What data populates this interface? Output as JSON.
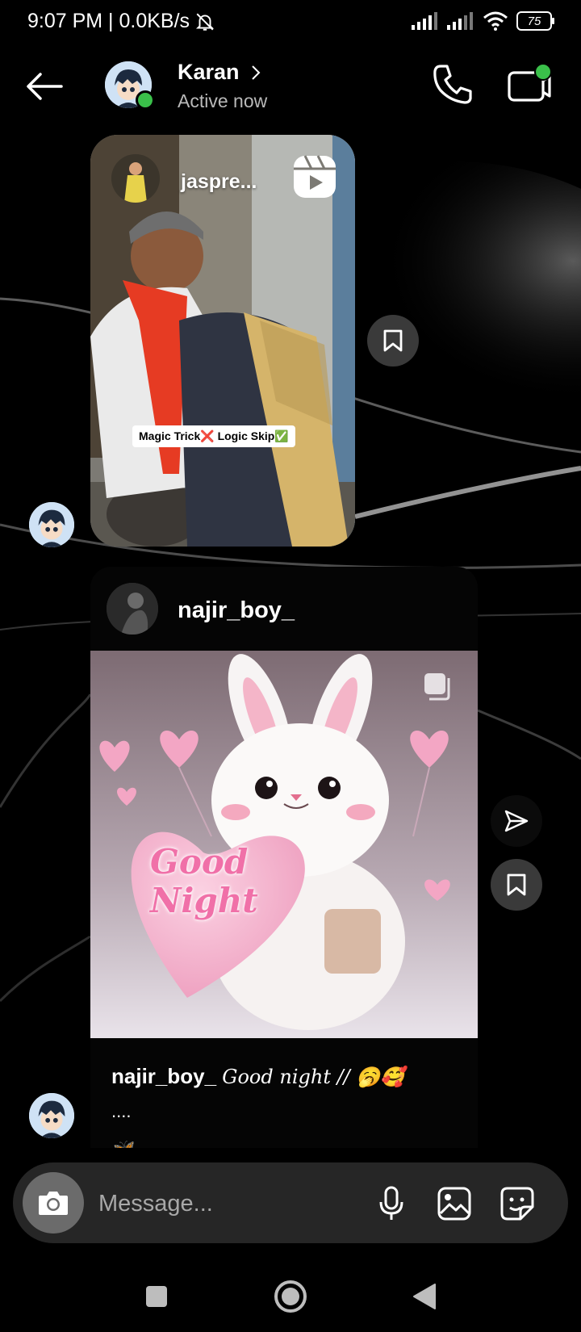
{
  "status_bar": {
    "time": "9:07 PM | 0.0KB/s",
    "battery": "75"
  },
  "header": {
    "contact_name": "Karan",
    "contact_status": "Active now",
    "icons": [
      "back-arrow-icon",
      "chevron-right-icon",
      "phone-icon",
      "video-call-icon"
    ]
  },
  "reel_message": {
    "username": "jaspre...",
    "caption_overlay": "Magic Trick❌ Logic Skip✅"
  },
  "post_message": {
    "username": "najir_boy_",
    "image_text_line1": "Good",
    "image_text_line2": "Night",
    "caption_user": "najir_boy_",
    "caption_text": "Good night // 🥱🥰",
    "caption_more": "....",
    "caption_emoji": "🦋"
  },
  "composer": {
    "placeholder": "Message...",
    "icons": [
      "camera-icon",
      "microphone-icon",
      "gallery-icon",
      "sticker-icon"
    ]
  },
  "colors": {
    "online": "#3ac04a",
    "composer_bg": "#262626",
    "camera_bg": "#6b6b6b"
  }
}
